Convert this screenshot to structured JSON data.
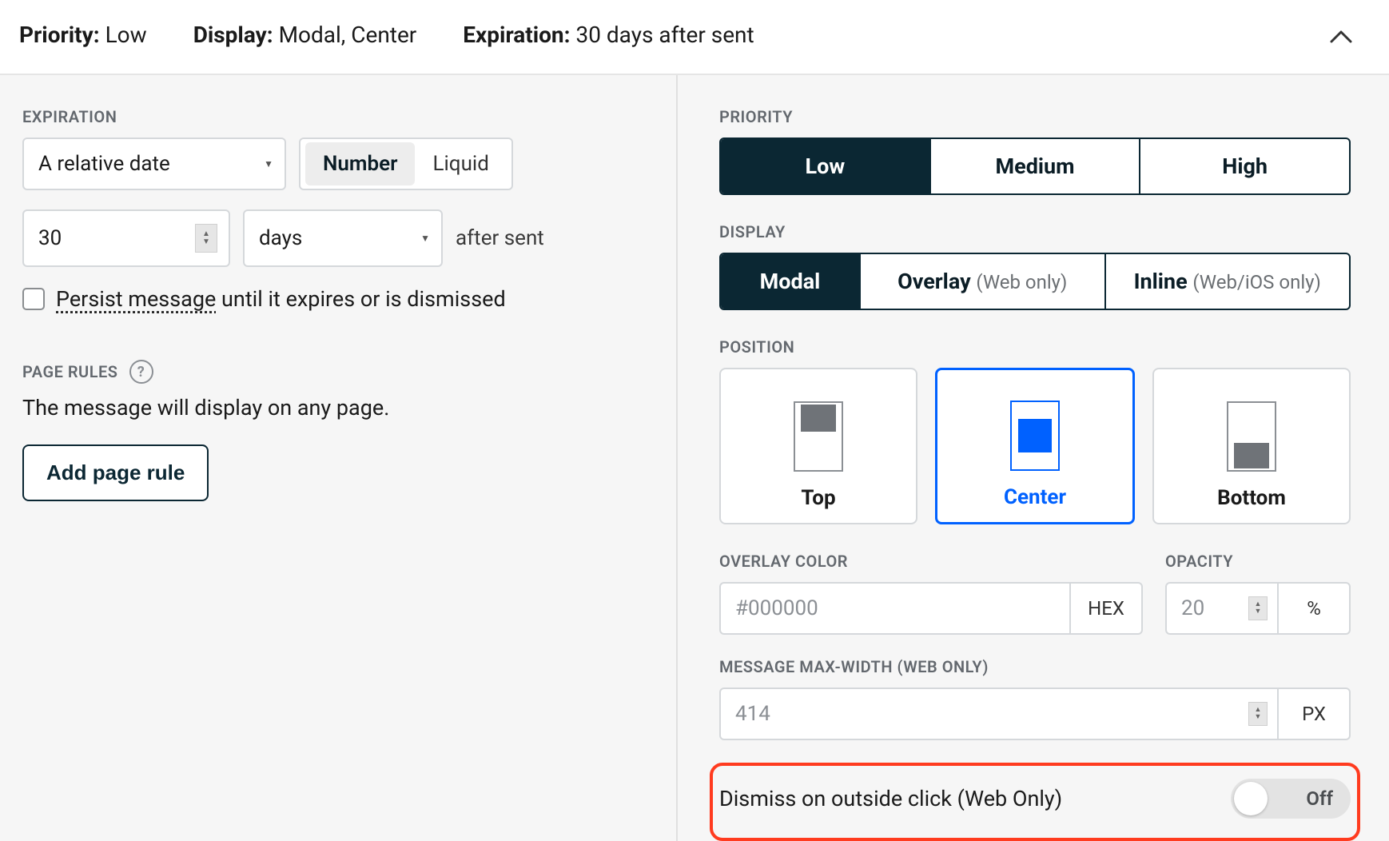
{
  "header": {
    "priority_label": "Priority:",
    "priority_value": "Low",
    "display_label": "Display:",
    "display_value": "Modal, Center",
    "expiration_label": "Expiration:",
    "expiration_value": "30 days after sent"
  },
  "expiration": {
    "section_label": "EXPIRATION",
    "date_type": "A relative date",
    "format_options": {
      "number": "Number",
      "liquid": "Liquid"
    },
    "number_value": "30",
    "unit": "days",
    "after_text": "after sent",
    "persist_underlined": "Persist message",
    "persist_rest": " until it expires or is dismissed"
  },
  "page_rules": {
    "section_label": "PAGE RULES",
    "description": "The message will display on any page.",
    "add_button": "Add page rule"
  },
  "priority": {
    "section_label": "PRIORITY",
    "options": [
      "Low",
      "Medium",
      "High"
    ],
    "selected": "Low"
  },
  "display": {
    "section_label": "DISPLAY",
    "options": [
      {
        "label": "Modal",
        "hint": ""
      },
      {
        "label": "Overlay",
        "hint": "(Web only)"
      },
      {
        "label": "Inline",
        "hint": "(Web/iOS only)"
      }
    ],
    "selected": "Modal"
  },
  "position": {
    "section_label": "POSITION",
    "options": [
      "Top",
      "Center",
      "Bottom"
    ],
    "selected": "Center"
  },
  "overlay": {
    "color_label": "OVERLAY COLOR",
    "color_value": "#000000",
    "color_unit": "HEX",
    "opacity_label": "OPACITY",
    "opacity_value": "20",
    "opacity_unit": "%"
  },
  "maxwidth": {
    "label": "MESSAGE MAX-WIDTH (WEB ONLY)",
    "value": "414",
    "unit": "PX"
  },
  "dismiss": {
    "label": "Dismiss on outside click (Web Only)",
    "state": "Off"
  }
}
